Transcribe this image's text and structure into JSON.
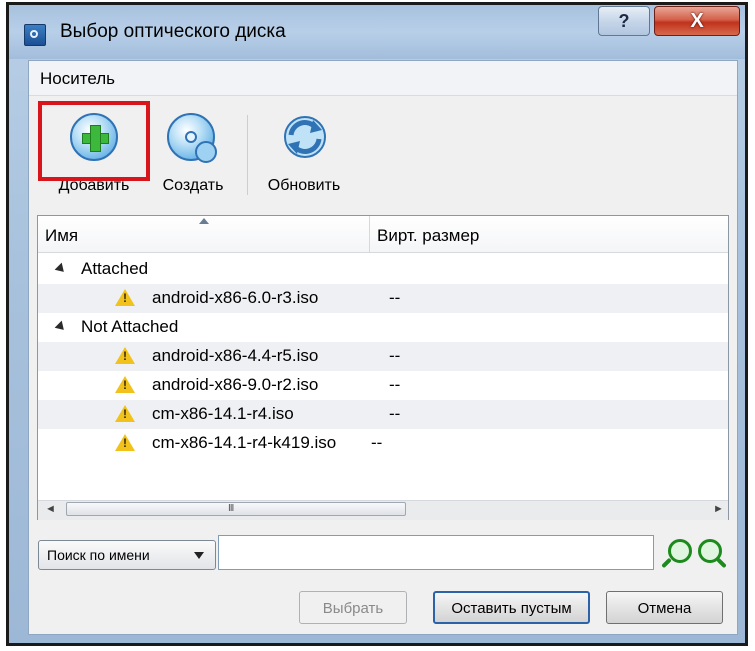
{
  "window": {
    "title": "Выбор оптического диска",
    "help_label": "?",
    "close_label": "X"
  },
  "menu": {
    "items": [
      "Носитель"
    ]
  },
  "toolbar": {
    "add_label": "Добавить",
    "create_label": "Создать",
    "refresh_label": "Обновить"
  },
  "table": {
    "columns": [
      "Имя",
      "Вирт. размер"
    ],
    "groups": [
      {
        "label": "Attached",
        "items": [
          {
            "name": "android-x86-6.0-r3.iso",
            "size": "--"
          }
        ]
      },
      {
        "label": "Not Attached",
        "items": [
          {
            "name": "android-x86-4.4-r5.iso",
            "size": "--"
          },
          {
            "name": "android-x86-9.0-r2.iso",
            "size": "--"
          },
          {
            "name": "cm-x86-14.1-r4.iso",
            "size": "--"
          },
          {
            "name": "cm-x86-14.1-r4-k419.iso",
            "size": "--"
          }
        ]
      }
    ],
    "scroll_left": "◄",
    "scroll_right": "►",
    "scroll_grip": "III"
  },
  "search": {
    "mode_label": "Поиск по имени",
    "value": "",
    "placeholder": ""
  },
  "buttons": {
    "choose_label": "Выбрать",
    "leave_empty_label": "Оставить пустым",
    "cancel_label": "Отмена"
  },
  "colors": {
    "highlight": "#d9141b",
    "warning": "#f1c21b",
    "accent": "#2f73b5"
  },
  "icons": {
    "app": "optical-disc-app-icon",
    "add": "add-disc-icon",
    "create": "create-disc-icon",
    "refresh": "refresh-icon",
    "warning": "warning-icon",
    "find_prev": "search-prev-icon",
    "find_next": "search-next-icon"
  }
}
